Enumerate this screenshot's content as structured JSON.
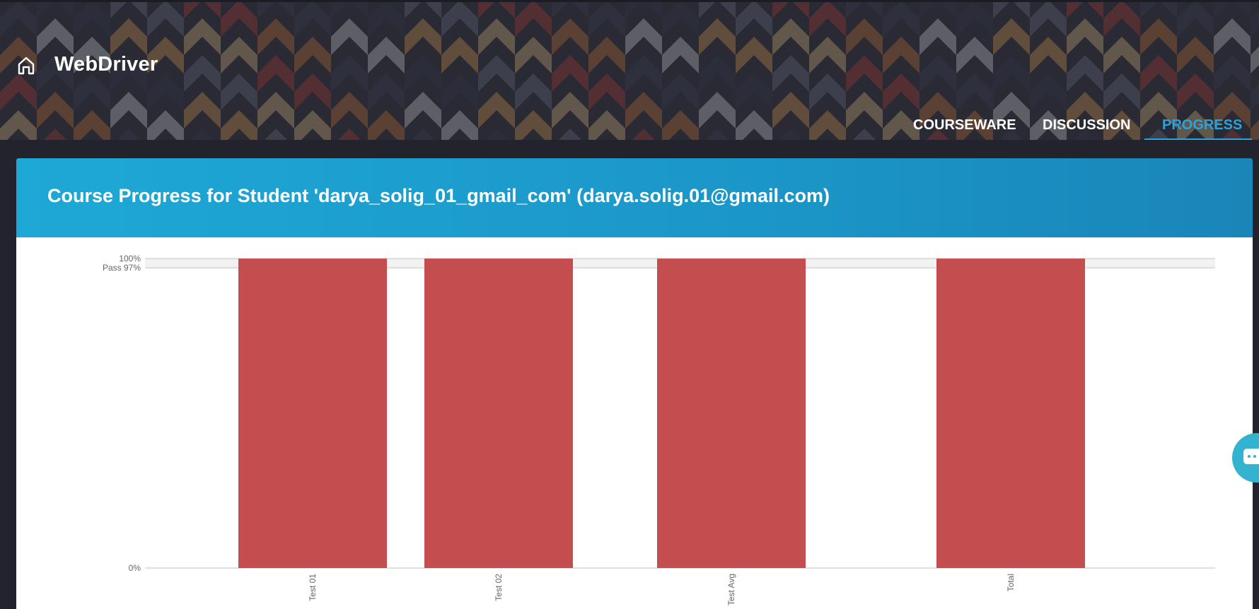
{
  "course": {
    "title": "WebDriver"
  },
  "nav": {
    "tabs": [
      {
        "label": "COURSEWARE",
        "active": false
      },
      {
        "label": "DISCUSSION",
        "active": false
      },
      {
        "label": "PROGRESS",
        "active": true
      }
    ]
  },
  "progress": {
    "heading": "Course Progress for Student 'darya_solig_01_gmail_com' (darya.solig.01@gmail.com)"
  },
  "colors": {
    "accent": "#29a3d9",
    "bar": "#c44e4f",
    "header_bg": "#1ea8d6"
  },
  "chart_data": {
    "type": "bar",
    "categories": [
      "Test 01",
      "Test 02",
      "Test Avg",
      "Total"
    ],
    "values": [
      100,
      100,
      100,
      100
    ],
    "ylim": [
      0,
      100
    ],
    "y_tick_labels": [
      "0%",
      "100%"
    ],
    "pass_line": {
      "value": 97,
      "label": "Pass 97%"
    },
    "xlabel": "",
    "ylabel": "",
    "grid": false
  }
}
